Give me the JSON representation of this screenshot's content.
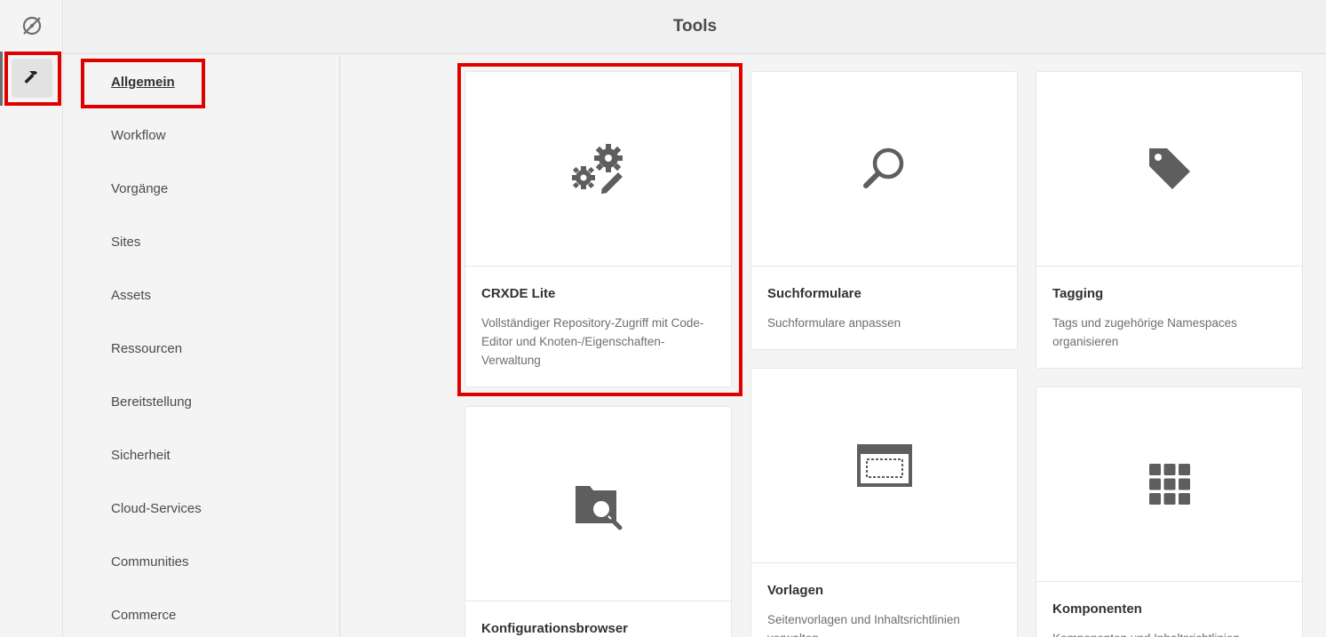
{
  "header": {
    "title": "Tools"
  },
  "categories": [
    {
      "label": "Allgemein",
      "active": true
    },
    {
      "label": "Workflow"
    },
    {
      "label": "Vorgänge"
    },
    {
      "label": "Sites"
    },
    {
      "label": "Assets"
    },
    {
      "label": "Ressourcen"
    },
    {
      "label": "Bereitstellung"
    },
    {
      "label": "Sicherheit"
    },
    {
      "label": "Cloud-Services"
    },
    {
      "label": "Communities"
    },
    {
      "label": "Commerce"
    }
  ],
  "cards": [
    {
      "icon": "gears-pencil-icon",
      "title": "CRXDE Lite",
      "desc": "Vollständiger Repository-Zugriff mit Code-Editor und Knoten-/Eigenschaften-Verwaltung"
    },
    {
      "icon": "search-icon",
      "title": "Suchformulare",
      "desc": "Suchformulare anpassen"
    },
    {
      "icon": "tag-icon",
      "title": "Tagging",
      "desc": "Tags und zugehörige Namespaces organisieren"
    },
    {
      "icon": "folder-search-icon",
      "title": "Konfigurationsbrowser",
      "desc": ""
    },
    {
      "icon": "template-icon",
      "title": "Vorlagen",
      "desc": "Seitenvorlagen und Inhaltsrichtlinien verwalten"
    },
    {
      "icon": "grid-icon",
      "title": "Komponenten",
      "desc": "Komponenten und Inhaltsrichtlinien"
    }
  ],
  "colors": {
    "highlight": "#e00000",
    "icon": "#5e5e5e"
  }
}
